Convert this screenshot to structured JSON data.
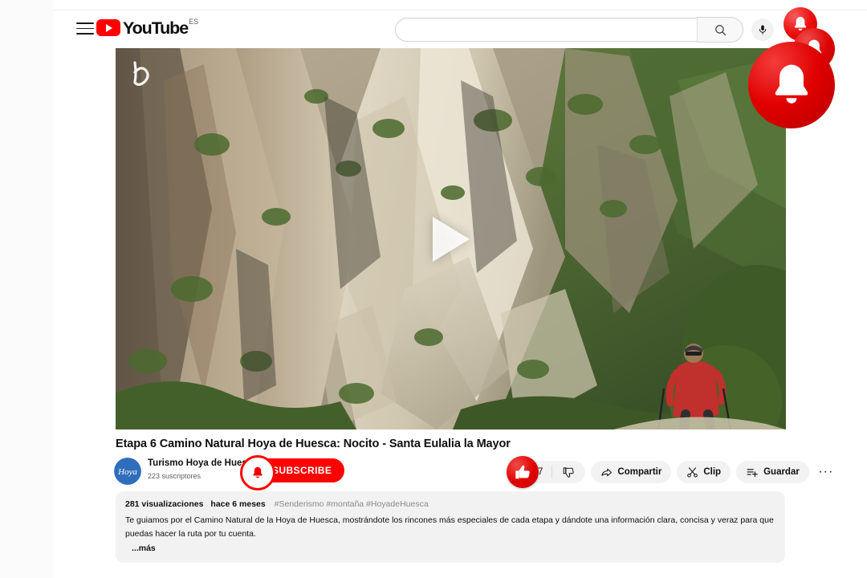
{
  "masthead": {
    "menu_icon": "hamburger-menu-icon",
    "logo_text": "YouTube",
    "country_code": "ES",
    "play_icon": "youtube-play-icon"
  },
  "search": {
    "value": "",
    "placeholder": "",
    "search_icon": "search-icon",
    "mic_icon": "microphone-icon"
  },
  "player": {
    "watermark": "channel-watermark-icon",
    "play_button_icon": "play-triangle-icon",
    "scene_description": "Mountain gorge with limestone cliffs, scree slopes, green forest and a hiker"
  },
  "video": {
    "title": "Etapa 6 Camino Natural Hoya de Huesca: Nocito - Santa Eulalia la Mayor"
  },
  "channel": {
    "name": "Turismo Hoya de Huesca",
    "subscribers": "223 suscriptores",
    "avatar_text": "Hoya",
    "avatar_icon": "channel-avatar"
  },
  "subscribe": {
    "label": "SUBSCRIBE",
    "bell_icon": "bell-icon"
  },
  "actions": {
    "like": {
      "label": "",
      "count": "7",
      "icon": "thumbs-up-icon",
      "highlight_icon": "thumbs-up-highlight-icon"
    },
    "dislike": {
      "icon": "thumbs-down-icon"
    },
    "share": {
      "label": "Compartir",
      "icon": "share-arrow-icon"
    },
    "clip": {
      "label": "Clip",
      "icon": "scissors-icon"
    },
    "save": {
      "label": "Guardar",
      "icon": "save-playlist-icon"
    },
    "more": {
      "label": "···",
      "icon": "more-horizontal-icon"
    }
  },
  "description": {
    "views": "281 visualizaciones",
    "published": "hace 6 meses",
    "hashtags": "#Senderismo #montaña #HoyadeHuesca",
    "body": "Te guiamos por el Camino Natural de la Hoya de Huesca, mostrándote los rincones más especiales de cada etapa y dándote una información clara, concisa y veraz para que puedas hacer la ruta por tu cuenta.",
    "more_label": "...más"
  },
  "notification_overlay": {
    "bell_small_icon": "bell-icon",
    "bell_mid_icon": "bell-icon",
    "bell_large_icon": "bell-icon"
  },
  "colors": {
    "brand_red": "#ff0000",
    "text_primary": "#0f0f0f",
    "text_secondary": "#606060",
    "chip_bg": "#f2f2f2"
  }
}
